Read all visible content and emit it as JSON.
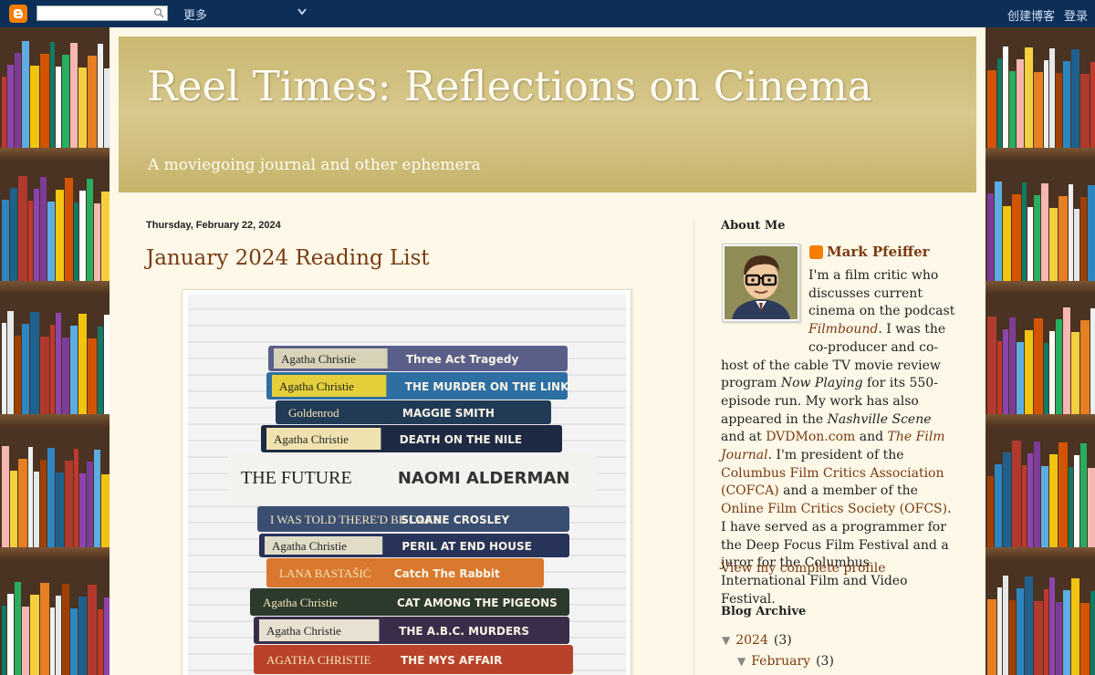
{
  "navbar": {
    "search_placeholder": "",
    "more_label": "更多",
    "create_blog_label": "创建博客",
    "login_label": "登录"
  },
  "header": {
    "title": "Reel Times: Reflections on Cinema",
    "description": "A moviegoing journal and other ephemera"
  },
  "post": {
    "date": "Thursday, February 22, 2024",
    "title": "January 2024 Reading List",
    "books": [
      {
        "author": "Agatha Christie",
        "title": "Three Act Tragedy"
      },
      {
        "author": "Agatha Christie",
        "title": "THE MURDER ON THE LINKS"
      },
      {
        "author": "Goldenrod",
        "title": "MAGGIE SMITH"
      },
      {
        "author": "Agatha Christie",
        "title": "DEATH ON THE NILE"
      },
      {
        "author": "THE FUTURE",
        "title": "NAOMI ALDERMAN"
      },
      {
        "author": "I WAS TOLD THERE'D BE CAKE",
        "title": "SLOANE CROSLEY"
      },
      {
        "author": "Agatha Christie",
        "title": "PERIL AT END HOUSE"
      },
      {
        "author": "LANA BASTAŠIĆ",
        "title": "Catch The Rabbit"
      },
      {
        "author": "Agatha Christie",
        "title": "CAT AMONG THE PIGEONS"
      },
      {
        "author": "Agatha Christie",
        "title": "THE A.B.C. MURDERS"
      },
      {
        "author": "AGATHA CHRISTIE",
        "title": "THE MYS AFFAIR"
      }
    ]
  },
  "sidebar": {
    "about_heading": "About Me",
    "profile_name": "Mark Pfeiffer",
    "bio": {
      "p1": "I'm a film critic who discusses current cinema on the podcast ",
      "podcast": "Filmbound",
      "p2": ". I was the co-producer and co-host of the cable TV movie review program ",
      "program": "Now Playing",
      "p3": " for its 550-episode run. My work has also appeared in the ",
      "scene": "Nashville Scene",
      "p4": " and at ",
      "dvdmon": "DVDMon.com",
      "p5": " and ",
      "filmjournal": "The Film Journal",
      "p6": ". I'm president of the ",
      "cofca": "Columbus Film Critics Association (COFCA)",
      "p7": " and a member of the ",
      "ofcs": "Online Film Critics Society (OFCS)",
      "p8": ". I have served as a programmer for the Deep Focus Film Festival and a juror for the Columbus International Film and Video Festival."
    },
    "view_profile": "View my complete profile",
    "archive_heading": "Blog Archive",
    "archive": [
      {
        "label": "2024",
        "count": "(3)",
        "toggle": "▼"
      },
      {
        "label": "February",
        "count": "(3)",
        "toggle": "▼"
      }
    ]
  },
  "colors": {
    "navbar_bg": "#0d2f57",
    "page_bg": "#fdf8e8",
    "header_gold": "#c8b870",
    "link_color": "#7a3a10"
  }
}
